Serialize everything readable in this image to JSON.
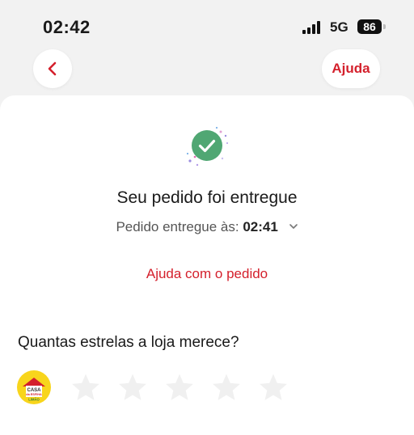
{
  "status_bar": {
    "time": "02:42",
    "network": "5G",
    "battery": "86"
  },
  "header": {
    "back_icon": "chevron-left-icon",
    "help_label": "Ajuda"
  },
  "order": {
    "title": "Seu pedido foi entregue",
    "delivered_prefix": "Pedido entregue às:",
    "delivered_time": "02:41",
    "help_link": "Ajuda com o pedido"
  },
  "rating": {
    "question": "Quantas estrelas a loja merece?",
    "store_logo_text": [
      "CASA",
      "da ESFIHA",
      "LIMÃO"
    ],
    "stars_total": 5,
    "stars_selected": 0
  },
  "colors": {
    "accent": "#d4202c",
    "success": "#50a773",
    "star_empty": "#f0f0f0"
  }
}
